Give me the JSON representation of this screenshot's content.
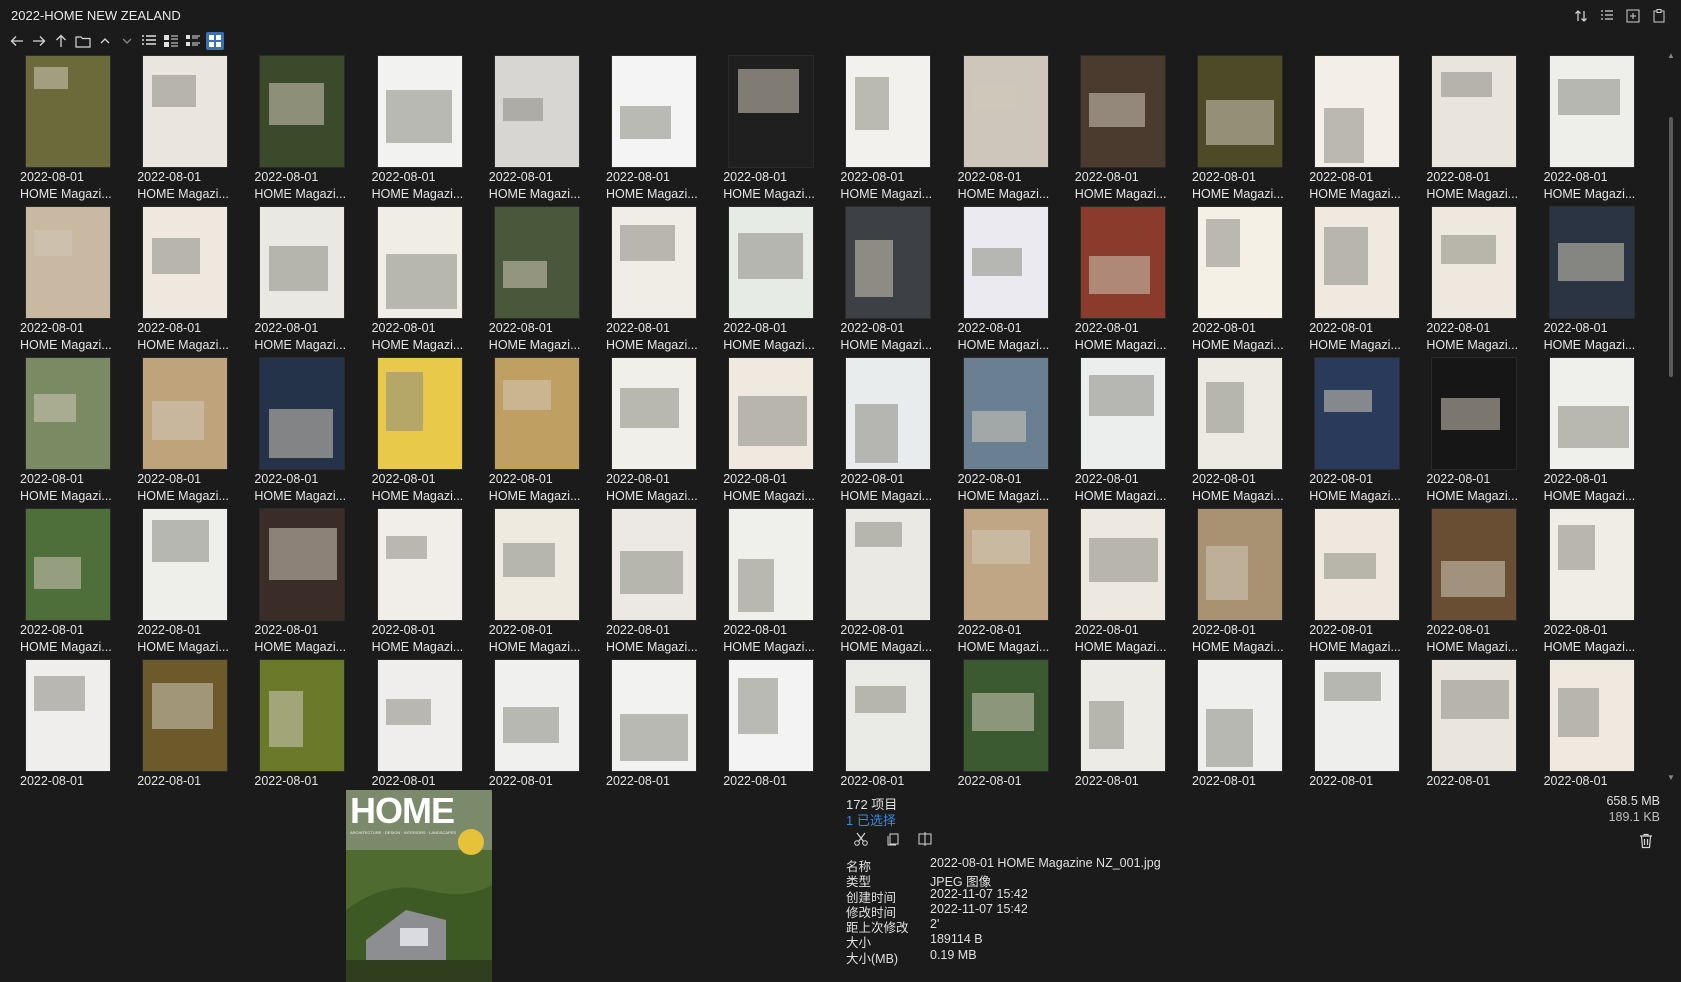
{
  "window": {
    "title": "2022-HOME NEW ZEALAND"
  },
  "title_actions": [
    {
      "icon": "sort-icon"
    },
    {
      "icon": "list-view-icon"
    },
    {
      "icon": "new-folder-icon"
    },
    {
      "icon": "paste-icon"
    }
  ],
  "toolbar": [
    {
      "icon": "back-arrow-icon"
    },
    {
      "icon": "forward-arrow-icon"
    },
    {
      "icon": "up-arrow-icon"
    },
    {
      "icon": "folder-icon"
    },
    {
      "icon": "chevron-up-icon"
    },
    {
      "icon": "chevron-down-icon"
    },
    {
      "icon": "details-view-icon"
    },
    {
      "icon": "tiles-view-icon"
    },
    {
      "icon": "content-view-icon"
    },
    {
      "icon": "thumbnails-view-icon",
      "active": true
    }
  ],
  "grid": {
    "date_label": "2022-08-01",
    "name_label": "HOME Magazi...",
    "rows": [
      [
        "#6b6a3a",
        "#eae6df",
        "#3c4a2c",
        "#f2f2f0",
        "#d8d6d2",
        "#f4f4f4",
        "#1f1f1f",
        "#f3f1ed",
        "#cfc6bb",
        "#4a3b2e",
        "#4d4a28",
        "#f3efe8",
        "#e9e5dd",
        "#eeeeea"
      ],
      [
        "#c9b8a2",
        "#eee8df",
        "#eae8e2",
        "#f0ede6",
        "#49583a",
        "#f0ece6",
        "#e6ebe6",
        "#3d4045",
        "#eaeaf0",
        "#8a3b2c",
        "#f5f0e6",
        "#efe9df",
        "#efe8de",
        "#2a3442"
      ],
      [
        "#7a8a62",
        "#bfa37a",
        "#24324a",
        "#e8c94a",
        "#c0a062",
        "#f1efe9",
        "#efe9e0",
        "#e9ecec",
        "#6a7f92",
        "#eceeee",
        "#eceae2",
        "#2a3a5a",
        "#161616",
        "#eff0ec"
      ],
      [
        "#4e6e3a",
        "#eeeeea",
        "#3a2d28",
        "#f1ede8",
        "#eeeae0",
        "#ece9e4",
        "#efefec",
        "#ebe9e4",
        "#c0a684",
        "#ede8e0",
        "#a89272",
        "#efe8de",
        "#6a4e34",
        "#f0ece6"
      ],
      [
        "#efeeec",
        "#6c5a2a",
        "#6a7a2a",
        "#efeeec",
        "#f0f0ee",
        "#f2f2f0",
        "#f3f3f3",
        "#eaeae6",
        "#3b5a32",
        "#ecebe6",
        "#efefee",
        "#eeeeec",
        "#eae6de",
        "#efe9df"
      ]
    ],
    "last_row_partial": true
  },
  "preview": {
    "cover_title": "HOME",
    "cover_sub": "ARCHITECTURE · DESIGN · INTERIORS · LANDSCAPES"
  },
  "info": {
    "count": "172 项目",
    "selected": "1 已选择",
    "total_size": "658.5 MB",
    "selected_size": "189.1 KB",
    "actions": [
      {
        "icon": "cut-icon"
      },
      {
        "icon": "copy-icon"
      },
      {
        "icon": "compare-icon"
      }
    ],
    "properties": [
      {
        "label": "名称",
        "value": "2022-08-01 HOME Magazine NZ_001.jpg"
      },
      {
        "label": "类型",
        "value": "JPEG 图像"
      },
      {
        "label": "创建时间",
        "value": "2022-11-07  15:42"
      },
      {
        "label": "修改时间",
        "value": "2022-11-07  15:42"
      },
      {
        "label": "距上次修改",
        "value": "2'"
      },
      {
        "label": "大小",
        "value": "189114 B"
      },
      {
        "label": "大小(MB)",
        "value": "0.19 MB"
      }
    ]
  }
}
